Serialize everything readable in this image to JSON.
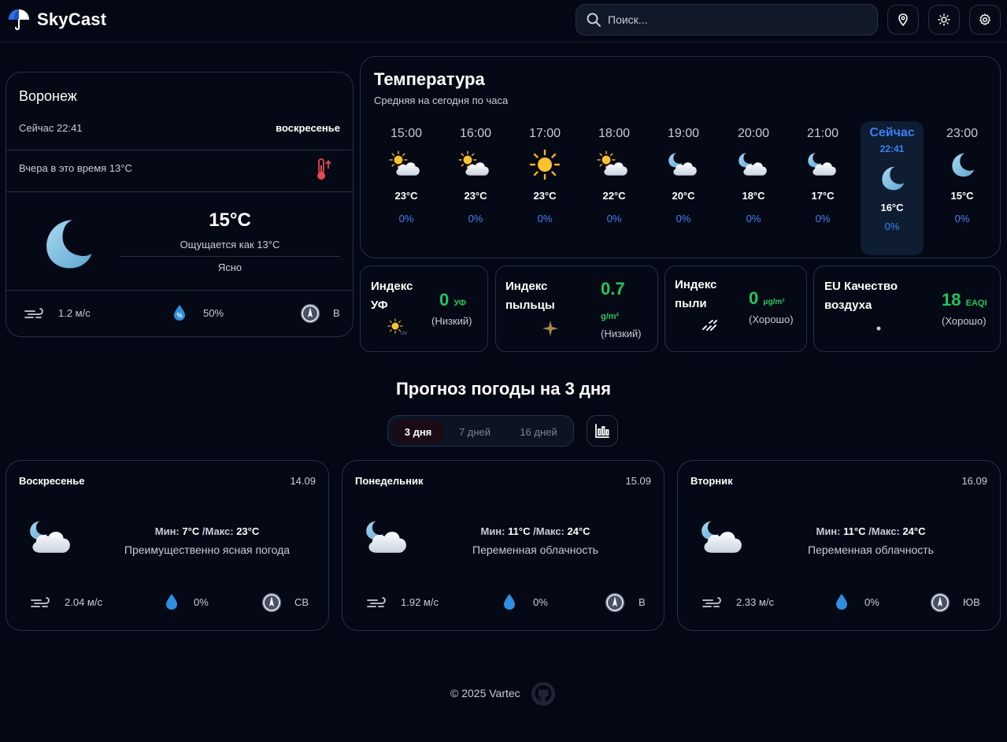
{
  "header": {
    "app_name": "SkyCast",
    "search_placeholder": "Поиск..."
  },
  "current": {
    "city": "Воронеж",
    "now_label": "Сейчас 22:41",
    "weekday": "воскресенье",
    "yesterday": "Вчера в это время 13°С",
    "temp": "15°C",
    "feels_like": "Ощущается как 13°C",
    "condition": "Ясно",
    "wind": "1.2 м/с",
    "humidity": "50%",
    "wind_dir": "В"
  },
  "temperature": {
    "title": "Температура",
    "subtitle": "Средняя на сегодня по часа",
    "hours": [
      {
        "time": "15:00",
        "temp": "23°C",
        "precip": "0%",
        "icon": "sun-cloud"
      },
      {
        "time": "16:00",
        "temp": "23°C",
        "precip": "0%",
        "icon": "sun-cloud"
      },
      {
        "time": "17:00",
        "temp": "23°C",
        "precip": "0%",
        "icon": "sun"
      },
      {
        "time": "18:00",
        "temp": "22°C",
        "precip": "0%",
        "icon": "sun-cloud"
      },
      {
        "time": "19:00",
        "temp": "20°C",
        "precip": "0%",
        "icon": "moon-cloud"
      },
      {
        "time": "20:00",
        "temp": "18°C",
        "precip": "0%",
        "icon": "moon-cloud"
      },
      {
        "time": "21:00",
        "temp": "17°C",
        "precip": "0%",
        "icon": "moon-cloud"
      },
      {
        "time": "Сейчас",
        "sub": "22:41",
        "temp": "16°C",
        "precip": "0%",
        "icon": "moon"
      },
      {
        "time": "23:00",
        "temp": "15°C",
        "precip": "0%",
        "icon": "moon"
      }
    ]
  },
  "indices": {
    "uv": {
      "title_1": "Индекс",
      "title_2": "УФ",
      "value": "0",
      "unit": "УФ",
      "level": "(Низкий)"
    },
    "pollen": {
      "title_1": "Индекс",
      "title_2": "пыльцы",
      "value": "0.7",
      "unit": "g/m²",
      "level": "(Низкий)"
    },
    "dust": {
      "title_1": "Индекс",
      "title_2": "пыли",
      "value": "0",
      "unit": "μg/m²",
      "level": "(Хорошо)"
    },
    "aqi": {
      "title_1": "EU Качество",
      "title_2": "воздуха",
      "value": "18",
      "unit": "EAQI",
      "level": "(Хорошо)"
    }
  },
  "forecast": {
    "title": "Прогноз погоды на 3 дня",
    "tabs": [
      "3 дня",
      "7 дней",
      "16 дней"
    ],
    "active_tab": "3 дня",
    "days": [
      {
        "name": "Воскресенье",
        "date": "14.09",
        "min_label": "Мин:",
        "min": "7°C",
        "max_label": "/Макс:",
        "max": "23°C",
        "desc": "Преимущественно ясная погода",
        "wind": "2.04 м/с",
        "precip": "0%",
        "dir": "СВ"
      },
      {
        "name": "Понедельник",
        "date": "15.09",
        "min_label": "Мин:",
        "min": "11°C",
        "max_label": "/Макс:",
        "max": "24°C",
        "desc": "Переменная облачность",
        "wind": "1.92 м/с",
        "precip": "0%",
        "dir": "В"
      },
      {
        "name": "Вторник",
        "date": "16.09",
        "min_label": "Мин:",
        "min": "11°C",
        "max_label": "/Макс:",
        "max": "24°C",
        "desc": "Переменная облачность",
        "wind": "2.33 м/с",
        "precip": "0%",
        "dir": "ЮВ"
      }
    ]
  },
  "footer": {
    "copyright": "© 2025 Vartec"
  },
  "colors": {
    "background": "#040714",
    "accent_blue": "#3b82f6",
    "good_green": "#22c55e"
  }
}
